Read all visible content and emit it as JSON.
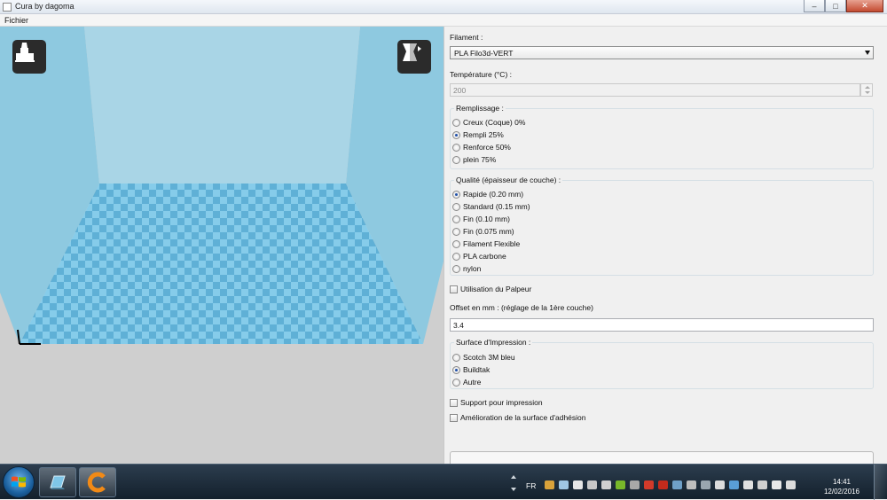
{
  "window": {
    "title": "Cura by dagoma",
    "minimize": "–",
    "maximize": "□",
    "close": "✕"
  },
  "menu": {
    "file": "Fichier"
  },
  "viewport": {
    "left_button_icon": "print-head-icon",
    "right_button_icon": "view-mode-icon"
  },
  "panel": {
    "filament_label": "Filament :",
    "filament_value": "PLA Filo3d-VERT",
    "temperature_label": "Température (°C) :",
    "temperature_value": "200",
    "infill": {
      "title": "Remplissage :",
      "options": [
        {
          "label": "Creux (Coque) 0%",
          "selected": false
        },
        {
          "label": "Rempli 25%",
          "selected": true
        },
        {
          "label": "Renforce 50%",
          "selected": false
        },
        {
          "label": "plein 75%",
          "selected": false
        }
      ]
    },
    "quality": {
      "title": "Qualité (épaisseur de couche) :",
      "options": [
        {
          "label": "Rapide (0.20 mm)",
          "selected": true
        },
        {
          "label": "Standard (0.15 mm)",
          "selected": false
        },
        {
          "label": "Fin (0.10 mm)",
          "selected": false
        },
        {
          "label": "Fin (0.075 mm)",
          "selected": false
        },
        {
          "label": "Filament Flexible",
          "selected": false
        },
        {
          "label": "PLA carbone",
          "selected": false
        },
        {
          "label": "nylon",
          "selected": false
        }
      ]
    },
    "probe_label": "Utilisation du Palpeur",
    "probe_checked": false,
    "offset_label": "Offset en mm : (réglage de la 1ère couche)",
    "offset_value": "3.4",
    "surface": {
      "title": "Surface d'Impression :",
      "options": [
        {
          "label": "Scotch 3M bleu",
          "selected": false
        },
        {
          "label": "Buildtak",
          "selected": true
        },
        {
          "label": "Autre",
          "selected": false
        }
      ]
    },
    "support_label": "Support pour impression",
    "support_checked": false,
    "adhesion_label": "Amélioration de la surface d'adhésion",
    "adhesion_checked": false
  },
  "taskbar": {
    "language": "FR",
    "time": "14:41",
    "date": "12/02/2016",
    "apps": [
      "explorer-app-icon",
      "cura-app-icon"
    ]
  },
  "colors": {
    "bed_light": "#86ccea",
    "bed_dark": "#54a8cf",
    "wall_side": "#88c6df",
    "wall_back": "#a7d3e5",
    "cura_orange": "#f28a16"
  }
}
